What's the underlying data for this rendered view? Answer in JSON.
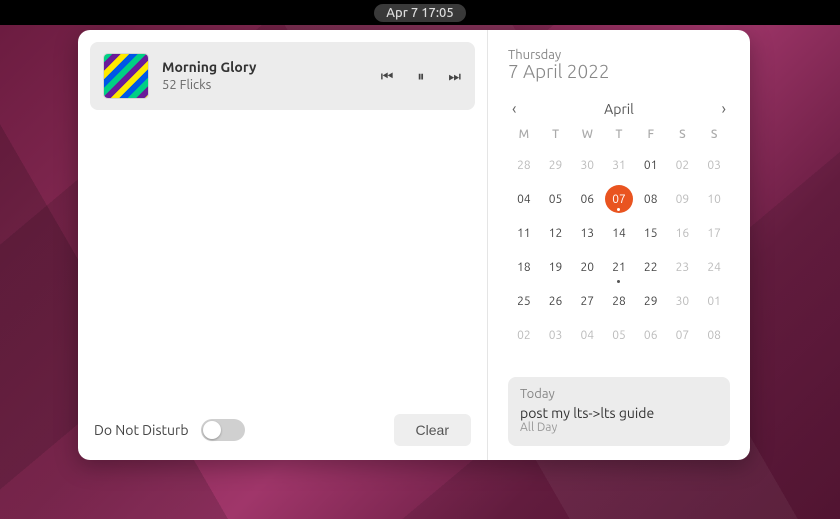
{
  "topbar": {
    "clock": "Apr 7  17:05"
  },
  "media": {
    "title": "Morning Glory",
    "artist": "52 Flicks",
    "prev_icon": "⏮",
    "play_icon": "⏸",
    "next_icon": "⏭"
  },
  "dnd": {
    "label": "Do Not Disturb",
    "enabled": false
  },
  "clear_label": "Clear",
  "date": {
    "weekday": "Thursday",
    "full": "7 April 2022"
  },
  "calendar": {
    "month_label": "April",
    "prev_icon": "‹",
    "next_icon": "›",
    "dow": [
      "M",
      "T",
      "W",
      "T",
      "F",
      "S",
      "S"
    ],
    "cells": [
      {
        "n": "28",
        "other": true
      },
      {
        "n": "29",
        "other": true
      },
      {
        "n": "30",
        "other": true
      },
      {
        "n": "31",
        "other": true
      },
      {
        "n": "01"
      },
      {
        "n": "02",
        "weekend": true
      },
      {
        "n": "03",
        "weekend": true
      },
      {
        "n": "04"
      },
      {
        "n": "05"
      },
      {
        "n": "06"
      },
      {
        "n": "07",
        "today": true,
        "event": true
      },
      {
        "n": "08"
      },
      {
        "n": "09",
        "weekend": true
      },
      {
        "n": "10",
        "weekend": true
      },
      {
        "n": "11"
      },
      {
        "n": "12"
      },
      {
        "n": "13"
      },
      {
        "n": "14"
      },
      {
        "n": "15"
      },
      {
        "n": "16",
        "weekend": true
      },
      {
        "n": "17",
        "weekend": true
      },
      {
        "n": "18"
      },
      {
        "n": "19"
      },
      {
        "n": "20"
      },
      {
        "n": "21",
        "event": true
      },
      {
        "n": "22"
      },
      {
        "n": "23",
        "weekend": true
      },
      {
        "n": "24",
        "weekend": true
      },
      {
        "n": "25"
      },
      {
        "n": "26"
      },
      {
        "n": "27"
      },
      {
        "n": "28"
      },
      {
        "n": "29"
      },
      {
        "n": "30",
        "weekend": true
      },
      {
        "n": "01",
        "other": true
      },
      {
        "n": "02",
        "other": true
      },
      {
        "n": "03",
        "other": true
      },
      {
        "n": "04",
        "other": true
      },
      {
        "n": "05",
        "other": true
      },
      {
        "n": "06",
        "other": true
      },
      {
        "n": "07",
        "other": true
      },
      {
        "n": "08",
        "other": true
      }
    ]
  },
  "events": {
    "heading": "Today",
    "title": "post my lts->lts guide",
    "time": "All Day"
  },
  "colors": {
    "accent": "#e95420"
  }
}
